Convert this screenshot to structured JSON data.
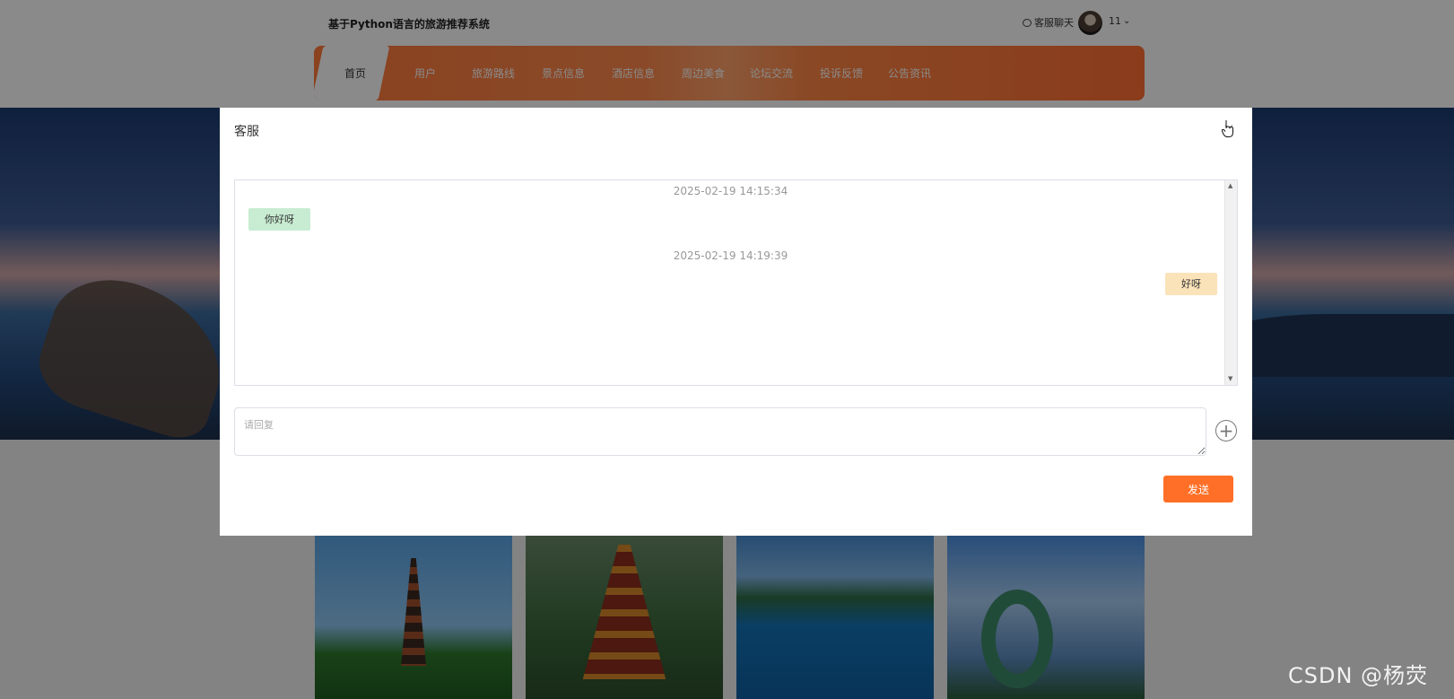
{
  "header": {
    "site_title": "基于Python语言的旅游推荐系统",
    "chat_link": "客服聊天",
    "user_name": "11"
  },
  "nav": {
    "items": [
      {
        "label": "首页",
        "active": true
      },
      {
        "label": "用户",
        "active": false
      },
      {
        "label": "旅游路线",
        "active": false
      },
      {
        "label": "景点信息",
        "active": false
      },
      {
        "label": "酒店信息",
        "active": false
      },
      {
        "label": "周边美食",
        "active": false
      },
      {
        "label": "论坛交流",
        "active": false
      },
      {
        "label": "投诉反馈",
        "active": false
      },
      {
        "label": "公告资讯",
        "active": false
      }
    ]
  },
  "modal": {
    "title": "客服",
    "close_icon": "close-icon",
    "messages": [
      {
        "time": "2025-02-19 14:15:34",
        "text": "你好呀",
        "side": "left"
      },
      {
        "time": "2025-02-19 14:19:39",
        "text": "好呀",
        "side": "right"
      }
    ],
    "reply_placeholder": "请回复",
    "reply_value": "",
    "add_icon": "add-circle-icon",
    "send_label": "发送"
  },
  "colors": {
    "accent": "#ff6f27",
    "left_bubble": "#c8ecd2",
    "right_bubble": "#fbe3b9"
  },
  "watermark": "CSDN @杨荧"
}
